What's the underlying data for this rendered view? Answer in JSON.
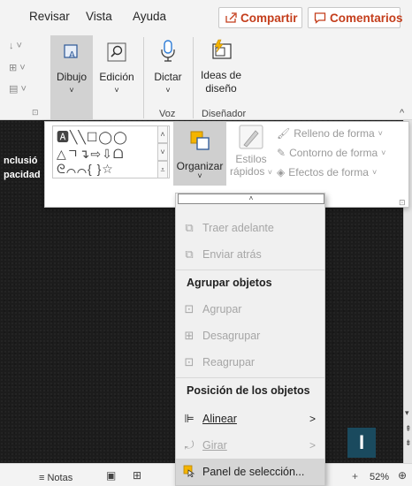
{
  "menubar": {
    "tabs": [
      "Revisar",
      "Vista",
      "Ayuda"
    ],
    "share_label": "Compartir",
    "comments_label": "Comentarios"
  },
  "ribbon": {
    "dibujo_label": "Dibujo",
    "edicion_label": "Edición",
    "dictar_label": "Dictar",
    "ideas_label_1": "Ideas de",
    "ideas_label_2": "diseño",
    "group_voz": "Voz",
    "group_disenador": "Diseñador"
  },
  "slide": {
    "text_line_1": "nclusió",
    "text_line_2": "pacidad"
  },
  "drawing_panel": {
    "organizar_label": "Organizar",
    "estilos_label_1": "Estilos",
    "estilos_label_2": "rápidos",
    "relleno_label": "Relleno de forma",
    "contorno_label": "Contorno de forma",
    "efectos_label": "Efectos de forma"
  },
  "organize_menu": {
    "traer_adelante": "Traer adelante",
    "enviar_atras": "Enviar atrás",
    "agrupar_header": "Agrupar objetos",
    "agrupar": "Agrupar",
    "desagrupar": "Desagrupar",
    "reagrupar": "Reagrupar",
    "posicion_header": "Posición de los objetos",
    "alinear": "Alinear",
    "girar": "Girar",
    "panel_seleccion": "Panel de selección..."
  },
  "statusbar": {
    "notas_label": "Notas",
    "zoom": "52%"
  },
  "logo_letter": "I",
  "colors": {
    "accent": "#c43e1c",
    "logo_bg": "#1a4a5e"
  }
}
